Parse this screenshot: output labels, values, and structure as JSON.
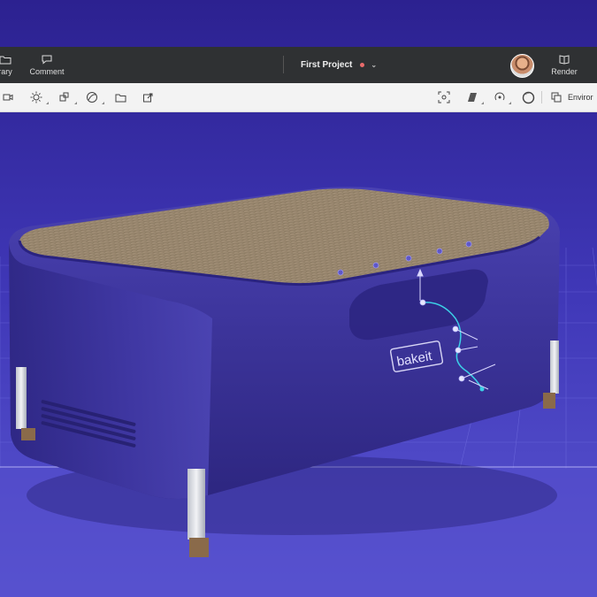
{
  "header": {
    "left_items": [
      {
        "label": "rary",
        "icon": "folder-icon"
      },
      {
        "label": "Comment",
        "icon": "comment-icon"
      }
    ],
    "project_title": "First Project",
    "unsaved_indicator_color": "#e96b6b",
    "right_items": [
      {
        "label": "Render",
        "icon": "book-render-icon"
      }
    ]
  },
  "toolbar": {
    "left_tools": [
      "camera-icon",
      "light-icon",
      "transform-icon",
      "material-icon",
      "folder-icon",
      "export-icon"
    ],
    "right_tools": [
      "focus-icon",
      "texture-icon",
      "rotate-icon",
      "sphere-icon"
    ],
    "environment_label": "Enviror"
  },
  "model": {
    "brand_text": "bakeit",
    "body_color": "#3b3396",
    "lid_color": "#9c8a6e"
  }
}
